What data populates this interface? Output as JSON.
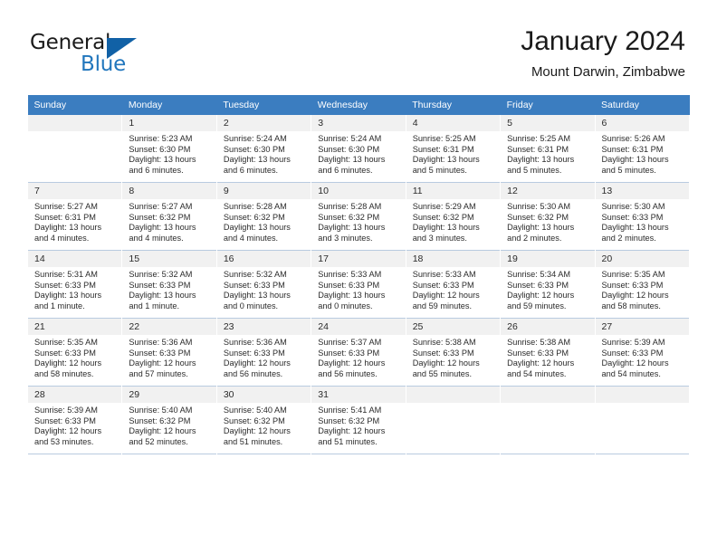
{
  "logo": {
    "text_primary": "General",
    "text_secondary": "Blue",
    "triangle_icon": "triangle-icon",
    "color_primary": "#1b1b1b",
    "color_secondary": "#2176bd",
    "triangle_color": "#1161a6"
  },
  "header": {
    "title": "January 2024",
    "subtitle": "Mount Darwin, Zimbabwe"
  },
  "theme": {
    "header_bg": "#3b7dc0",
    "header_text": "#ffffff",
    "daynum_bg": "#f1f1f1",
    "row_border": "#c3d2e2",
    "body_text": "#2b2b2b"
  },
  "weekdays": [
    "Sunday",
    "Monday",
    "Tuesday",
    "Wednesday",
    "Thursday",
    "Friday",
    "Saturday"
  ],
  "weeks": [
    [
      {
        "day": "",
        "sunrise": "",
        "sunset": "",
        "daylight1": "",
        "daylight2": ""
      },
      {
        "day": "1",
        "sunrise": "Sunrise: 5:23 AM",
        "sunset": "Sunset: 6:30 PM",
        "daylight1": "Daylight: 13 hours",
        "daylight2": "and 6 minutes."
      },
      {
        "day": "2",
        "sunrise": "Sunrise: 5:24 AM",
        "sunset": "Sunset: 6:30 PM",
        "daylight1": "Daylight: 13 hours",
        "daylight2": "and 6 minutes."
      },
      {
        "day": "3",
        "sunrise": "Sunrise: 5:24 AM",
        "sunset": "Sunset: 6:30 PM",
        "daylight1": "Daylight: 13 hours",
        "daylight2": "and 6 minutes."
      },
      {
        "day": "4",
        "sunrise": "Sunrise: 5:25 AM",
        "sunset": "Sunset: 6:31 PM",
        "daylight1": "Daylight: 13 hours",
        "daylight2": "and 5 minutes."
      },
      {
        "day": "5",
        "sunrise": "Sunrise: 5:25 AM",
        "sunset": "Sunset: 6:31 PM",
        "daylight1": "Daylight: 13 hours",
        "daylight2": "and 5 minutes."
      },
      {
        "day": "6",
        "sunrise": "Sunrise: 5:26 AM",
        "sunset": "Sunset: 6:31 PM",
        "daylight1": "Daylight: 13 hours",
        "daylight2": "and 5 minutes."
      }
    ],
    [
      {
        "day": "7",
        "sunrise": "Sunrise: 5:27 AM",
        "sunset": "Sunset: 6:31 PM",
        "daylight1": "Daylight: 13 hours",
        "daylight2": "and 4 minutes."
      },
      {
        "day": "8",
        "sunrise": "Sunrise: 5:27 AM",
        "sunset": "Sunset: 6:32 PM",
        "daylight1": "Daylight: 13 hours",
        "daylight2": "and 4 minutes."
      },
      {
        "day": "9",
        "sunrise": "Sunrise: 5:28 AM",
        "sunset": "Sunset: 6:32 PM",
        "daylight1": "Daylight: 13 hours",
        "daylight2": "and 4 minutes."
      },
      {
        "day": "10",
        "sunrise": "Sunrise: 5:28 AM",
        "sunset": "Sunset: 6:32 PM",
        "daylight1": "Daylight: 13 hours",
        "daylight2": "and 3 minutes."
      },
      {
        "day": "11",
        "sunrise": "Sunrise: 5:29 AM",
        "sunset": "Sunset: 6:32 PM",
        "daylight1": "Daylight: 13 hours",
        "daylight2": "and 3 minutes."
      },
      {
        "day": "12",
        "sunrise": "Sunrise: 5:30 AM",
        "sunset": "Sunset: 6:32 PM",
        "daylight1": "Daylight: 13 hours",
        "daylight2": "and 2 minutes."
      },
      {
        "day": "13",
        "sunrise": "Sunrise: 5:30 AM",
        "sunset": "Sunset: 6:33 PM",
        "daylight1": "Daylight: 13 hours",
        "daylight2": "and 2 minutes."
      }
    ],
    [
      {
        "day": "14",
        "sunrise": "Sunrise: 5:31 AM",
        "sunset": "Sunset: 6:33 PM",
        "daylight1": "Daylight: 13 hours",
        "daylight2": "and 1 minute."
      },
      {
        "day": "15",
        "sunrise": "Sunrise: 5:32 AM",
        "sunset": "Sunset: 6:33 PM",
        "daylight1": "Daylight: 13 hours",
        "daylight2": "and 1 minute."
      },
      {
        "day": "16",
        "sunrise": "Sunrise: 5:32 AM",
        "sunset": "Sunset: 6:33 PM",
        "daylight1": "Daylight: 13 hours",
        "daylight2": "and 0 minutes."
      },
      {
        "day": "17",
        "sunrise": "Sunrise: 5:33 AM",
        "sunset": "Sunset: 6:33 PM",
        "daylight1": "Daylight: 13 hours",
        "daylight2": "and 0 minutes."
      },
      {
        "day": "18",
        "sunrise": "Sunrise: 5:33 AM",
        "sunset": "Sunset: 6:33 PM",
        "daylight1": "Daylight: 12 hours",
        "daylight2": "and 59 minutes."
      },
      {
        "day": "19",
        "sunrise": "Sunrise: 5:34 AM",
        "sunset": "Sunset: 6:33 PM",
        "daylight1": "Daylight: 12 hours",
        "daylight2": "and 59 minutes."
      },
      {
        "day": "20",
        "sunrise": "Sunrise: 5:35 AM",
        "sunset": "Sunset: 6:33 PM",
        "daylight1": "Daylight: 12 hours",
        "daylight2": "and 58 minutes."
      }
    ],
    [
      {
        "day": "21",
        "sunrise": "Sunrise: 5:35 AM",
        "sunset": "Sunset: 6:33 PM",
        "daylight1": "Daylight: 12 hours",
        "daylight2": "and 58 minutes."
      },
      {
        "day": "22",
        "sunrise": "Sunrise: 5:36 AM",
        "sunset": "Sunset: 6:33 PM",
        "daylight1": "Daylight: 12 hours",
        "daylight2": "and 57 minutes."
      },
      {
        "day": "23",
        "sunrise": "Sunrise: 5:36 AM",
        "sunset": "Sunset: 6:33 PM",
        "daylight1": "Daylight: 12 hours",
        "daylight2": "and 56 minutes."
      },
      {
        "day": "24",
        "sunrise": "Sunrise: 5:37 AM",
        "sunset": "Sunset: 6:33 PM",
        "daylight1": "Daylight: 12 hours",
        "daylight2": "and 56 minutes."
      },
      {
        "day": "25",
        "sunrise": "Sunrise: 5:38 AM",
        "sunset": "Sunset: 6:33 PM",
        "daylight1": "Daylight: 12 hours",
        "daylight2": "and 55 minutes."
      },
      {
        "day": "26",
        "sunrise": "Sunrise: 5:38 AM",
        "sunset": "Sunset: 6:33 PM",
        "daylight1": "Daylight: 12 hours",
        "daylight2": "and 54 minutes."
      },
      {
        "day": "27",
        "sunrise": "Sunrise: 5:39 AM",
        "sunset": "Sunset: 6:33 PM",
        "daylight1": "Daylight: 12 hours",
        "daylight2": "and 54 minutes."
      }
    ],
    [
      {
        "day": "28",
        "sunrise": "Sunrise: 5:39 AM",
        "sunset": "Sunset: 6:33 PM",
        "daylight1": "Daylight: 12 hours",
        "daylight2": "and 53 minutes."
      },
      {
        "day": "29",
        "sunrise": "Sunrise: 5:40 AM",
        "sunset": "Sunset: 6:32 PM",
        "daylight1": "Daylight: 12 hours",
        "daylight2": "and 52 minutes."
      },
      {
        "day": "30",
        "sunrise": "Sunrise: 5:40 AM",
        "sunset": "Sunset: 6:32 PM",
        "daylight1": "Daylight: 12 hours",
        "daylight2": "and 51 minutes."
      },
      {
        "day": "31",
        "sunrise": "Sunrise: 5:41 AM",
        "sunset": "Sunset: 6:32 PM",
        "daylight1": "Daylight: 12 hours",
        "daylight2": "and 51 minutes."
      },
      {
        "day": "",
        "sunrise": "",
        "sunset": "",
        "daylight1": "",
        "daylight2": ""
      },
      {
        "day": "",
        "sunrise": "",
        "sunset": "",
        "daylight1": "",
        "daylight2": ""
      },
      {
        "day": "",
        "sunrise": "",
        "sunset": "",
        "daylight1": "",
        "daylight2": ""
      }
    ]
  ]
}
